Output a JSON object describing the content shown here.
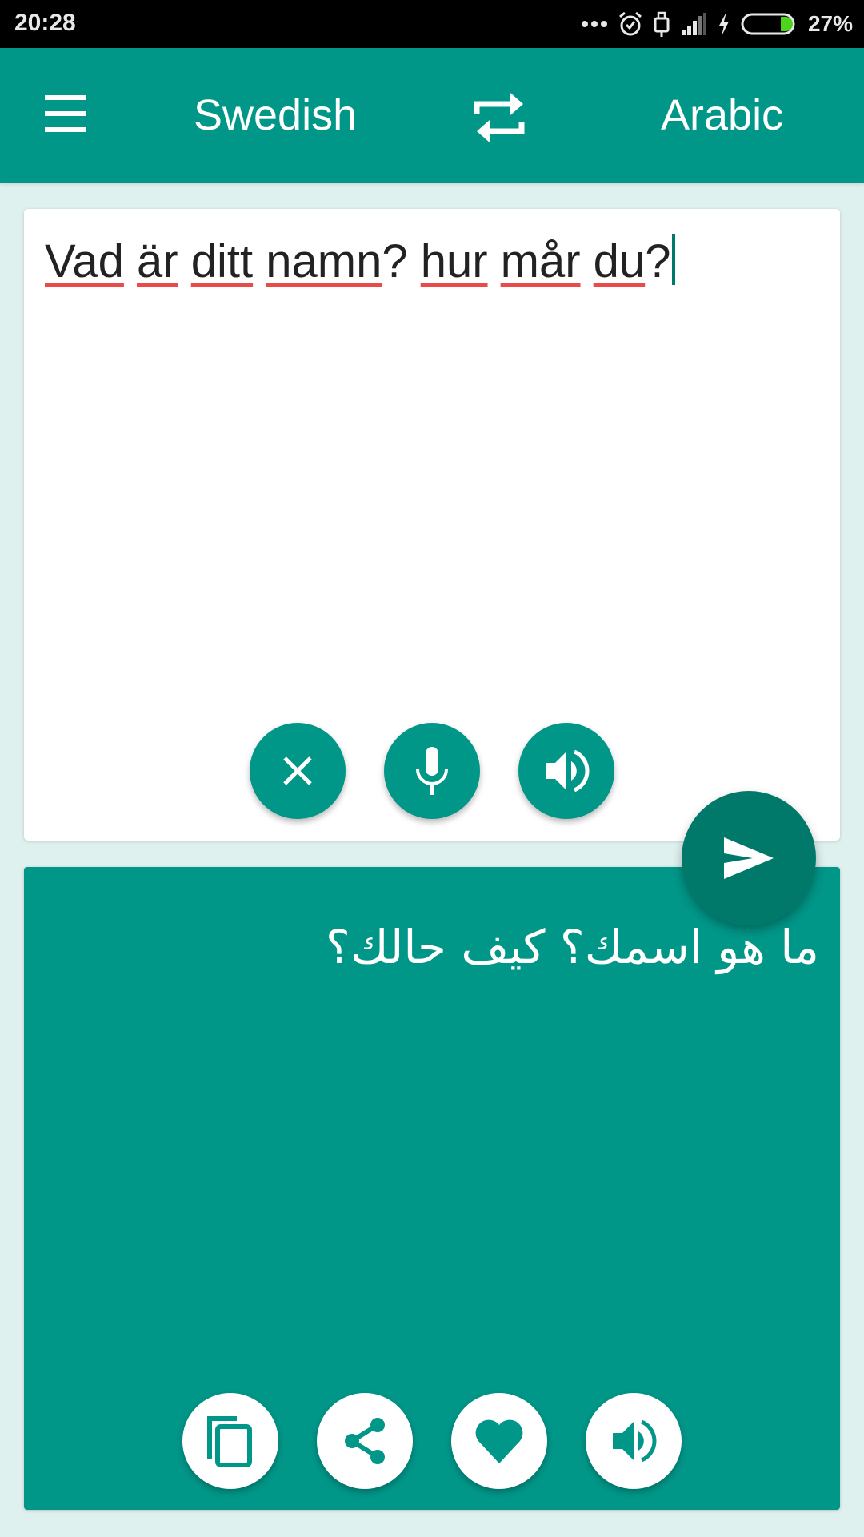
{
  "status_bar": {
    "time": "20:28",
    "icons": [
      "more-dots-icon",
      "alarm-icon",
      "usb-icon",
      "signal-icon",
      "charging-icon",
      "battery-icon"
    ],
    "battery_percent": "27%",
    "battery_level": 0.27
  },
  "toolbar": {
    "menu_icon": "hamburger-menu-icon",
    "source_language": "Swedish",
    "swap_icon": "swap-languages-icon",
    "target_language": "Arabic"
  },
  "input": {
    "words": [
      "Vad",
      "är",
      "ditt",
      "namn",
      "hur",
      "mår",
      "du"
    ],
    "text": "Vad är ditt namn? hur mår du?",
    "buttons": [
      {
        "name": "clear",
        "icon": "close-icon"
      },
      {
        "name": "voice-input",
        "icon": "microphone-icon"
      },
      {
        "name": "speak-source",
        "icon": "speaker-icon"
      }
    ]
  },
  "translate_button": {
    "icon": "send-icon"
  },
  "output": {
    "text": "ما هو اسمك؟ كيف حالك؟",
    "buttons": [
      {
        "name": "copy",
        "icon": "copy-icon"
      },
      {
        "name": "share",
        "icon": "share-icon"
      },
      {
        "name": "favorite",
        "icon": "heart-icon"
      },
      {
        "name": "speak-translation",
        "icon": "speaker-icon"
      }
    ]
  },
  "colors": {
    "primary": "#009688",
    "primary_dark": "#00796b",
    "background": "#dff1ef",
    "spellcheck_underline": "#e94a4a",
    "battery_fill": "#4cd31d"
  }
}
